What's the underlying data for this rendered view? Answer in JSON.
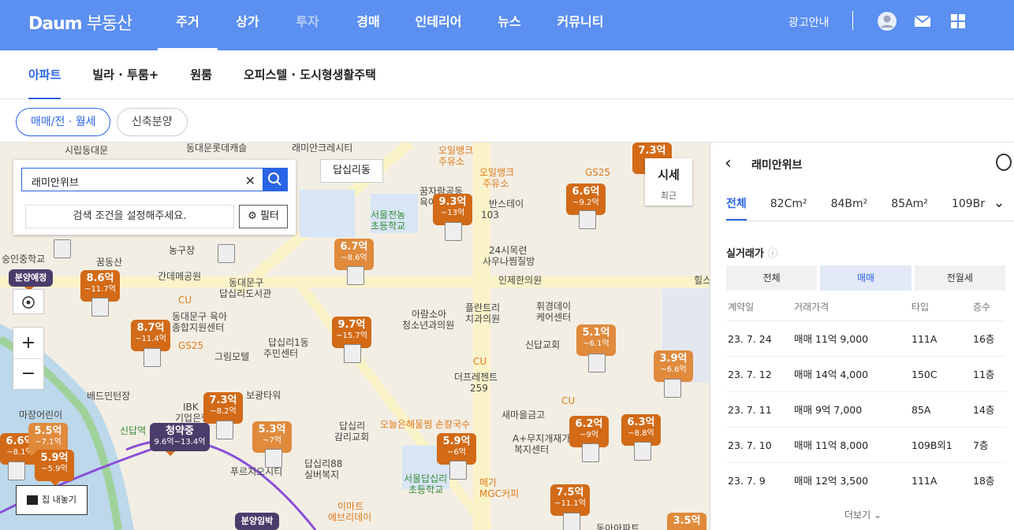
{
  "header": {
    "logo": "Daum",
    "logo_sub": "부동산",
    "nav": [
      "주거",
      "상가",
      "투자",
      "경매",
      "인테리어",
      "뉴스",
      "커뮤니티"
    ],
    "ad_link": "광고안내"
  },
  "subnav": [
    "아파트",
    "빌라 · 투룸+",
    "원룸",
    "오피스텔 · 도시형생활주택"
  ],
  "pills": [
    "매매/전 · 월세",
    "신축분양"
  ],
  "search": {
    "value": "래미안위브",
    "hint": "검색 조건을 설정해주세요.",
    "filter": "필터"
  },
  "map": {
    "dong": "답십리동",
    "sise": "시세",
    "sise_sub": "최근",
    "home_out": "집 내놓기",
    "badges": [
      {
        "t": "청약중",
        "s": "9.6억~13.4억"
      },
      {
        "t": "분양예정"
      },
      {
        "t": "분양임박"
      }
    ],
    "pins": [
      {
        "p": "9.3억",
        "r": "~13억"
      },
      {
        "p": "6.7억",
        "r": "~8.6억"
      },
      {
        "p": "6.6억",
        "r": "~9.2억"
      },
      {
        "p": "7.3억",
        "r": ""
      },
      {
        "p": "8.6억",
        "r": "~11.7억"
      },
      {
        "p": "8.7억",
        "r": "~11.4억"
      },
      {
        "p": "9.7억",
        "r": "~15.7억"
      },
      {
        "p": "5.1억",
        "r": "~6.1억"
      },
      {
        "p": "3.9억",
        "r": "~6.6억"
      },
      {
        "p": "7.3억",
        "r": "~8.2억"
      },
      {
        "p": "5.3억",
        "r": "~7억"
      },
      {
        "p": "5.9억",
        "r": "~6억"
      },
      {
        "p": "6.2억",
        "r": "~9억"
      },
      {
        "p": "6.3억",
        "r": "~8.8억"
      },
      {
        "p": "7.5억",
        "r": "~11.1억"
      },
      {
        "p": "6.6억",
        "r": "~8.1억"
      },
      {
        "p": "5.5억",
        "r": "~7.1억"
      },
      {
        "p": "5.9억",
        "r": "~5.9억"
      },
      {
        "p": "3.5억",
        "r": ""
      }
    ],
    "labels": [
      "시립동대문",
      "동대문롯데캐슬",
      "래미안크레시티",
      "오일뱅크",
      "주유소",
      "오일뱅크",
      "주유소",
      "꿈자람공동",
      "육아나눔터",
      "반스테이",
      "103",
      "24시목련",
      "사우나찜질방",
      "인제한의원",
      "플란트리",
      "치과의원",
      "휘경데이",
      "케어센터",
      "신답교회",
      "더프레젠트",
      "259",
      "새마을금고",
      "A+무지개재가",
      "복지센터",
      "오늘은해물찜 손칼국수",
      "메가",
      "MGC커피",
      "이마트",
      "에브리데이",
      "답십리88",
      "실버복지",
      "푸르지오시티",
      "보광타워",
      "IBK",
      "기업은행",
      "답십리",
      "감리교회",
      "서울답십리",
      "초등학교",
      "서울전농",
      "초등학교",
      "동대문구",
      "답십리도서관",
      "동대문구 육아",
      "종합지원센터",
      "답십리1동",
      "주민센터",
      "그림모텔",
      "아람소아",
      "청소년과의원",
      "동아아파트",
      "간데메공원",
      "농구장",
      "꿈동산",
      "마장어린이",
      "배드민턴장",
      "신답역",
      "숭인중학교",
      "힐스",
      "CU",
      "GS25",
      "CU",
      "GS25",
      "CU"
    ]
  },
  "panel": {
    "title": "래미안위브",
    "tabs": [
      "전체",
      "82Cm²",
      "84Bm²",
      "85Am²",
      "109Bm²"
    ],
    "section": "실거래가",
    "segs": [
      "전체",
      "매매",
      "전월세"
    ],
    "cols": [
      "계약일",
      "거래가격",
      "타입",
      "층수"
    ],
    "rows": [
      [
        "23. 7. 24",
        "매매 11억 9,000",
        "111A",
        "16층"
      ],
      [
        "23. 7. 12",
        "매매 14억 4,000",
        "150C",
        "11층"
      ],
      [
        "23. 7. 11",
        "매매 9억 7,000",
        "85A",
        "14층"
      ],
      [
        "23. 7. 10",
        "매매 11억 8,000",
        "109B외1",
        "7층"
      ],
      [
        "23. 7. 9",
        "매매 12억 3,500",
        "111A",
        "18층"
      ]
    ],
    "more": "더보기"
  }
}
